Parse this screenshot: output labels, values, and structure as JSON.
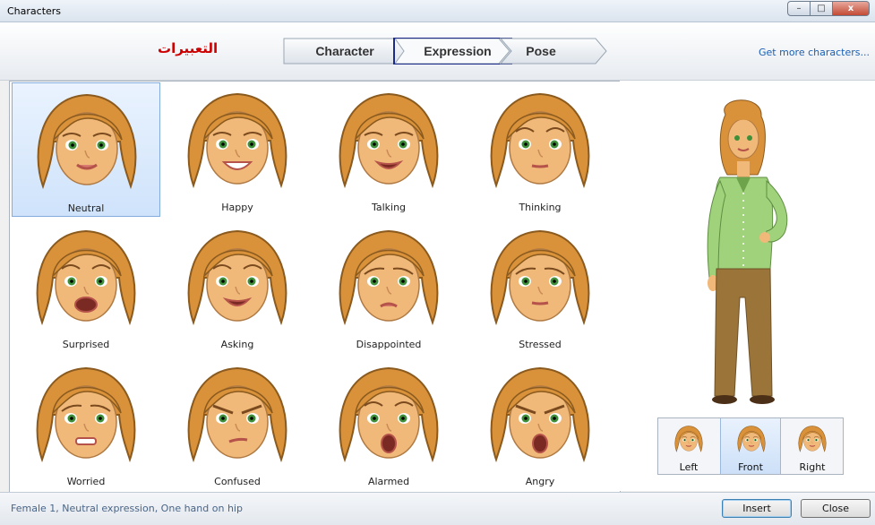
{
  "window": {
    "title": "Characters",
    "buttons": [
      "minimize",
      "maximize",
      "close"
    ]
  },
  "header": {
    "arabic_title": "التعبيرات",
    "steps": [
      {
        "label": "Character",
        "active": false
      },
      {
        "label": "Expression",
        "active": true
      },
      {
        "label": "Pose",
        "active": false
      }
    ],
    "get_more": "Get more characters..."
  },
  "expressions": [
    {
      "label": "Neutral",
      "selected": true,
      "mouth": "smile",
      "brow": "normal"
    },
    {
      "label": "Happy",
      "selected": false,
      "mouth": "grin",
      "brow": "normal"
    },
    {
      "label": "Talking",
      "selected": false,
      "mouth": "open",
      "brow": "normal"
    },
    {
      "label": "Thinking",
      "selected": false,
      "mouth": "flat",
      "brow": "raised"
    },
    {
      "label": "Surprised",
      "selected": false,
      "mouth": "wide",
      "brow": "raised"
    },
    {
      "label": "Asking",
      "selected": false,
      "mouth": "open",
      "brow": "raised"
    },
    {
      "label": "Disappointed",
      "selected": false,
      "mouth": "frown",
      "brow": "sad"
    },
    {
      "label": "Stressed",
      "selected": false,
      "mouth": "flat",
      "brow": "sad"
    },
    {
      "label": "Worried",
      "selected": false,
      "mouth": "teeth",
      "brow": "sad"
    },
    {
      "label": "Confused",
      "selected": false,
      "mouth": "smirk",
      "brow": "angry"
    },
    {
      "label": "Alarmed",
      "selected": false,
      "mouth": "shout",
      "brow": "raised"
    },
    {
      "label": "Angry",
      "selected": false,
      "mouth": "shout",
      "brow": "angry"
    }
  ],
  "pose_views": [
    {
      "label": "Left",
      "selected": false
    },
    {
      "label": "Front",
      "selected": true
    },
    {
      "label": "Right",
      "selected": false
    }
  ],
  "status": "Female 1, Neutral expression, One hand on hip",
  "buttons": {
    "insert": "Insert",
    "close": "Close"
  },
  "colors": {
    "hair": "#d9913a",
    "skin": "#f0b979",
    "eyes": "#3f8f3a",
    "shirt": "#9fd27a",
    "pants": "#9a7438",
    "accent_red": "#cc0000",
    "link": "#1a5fb4"
  }
}
